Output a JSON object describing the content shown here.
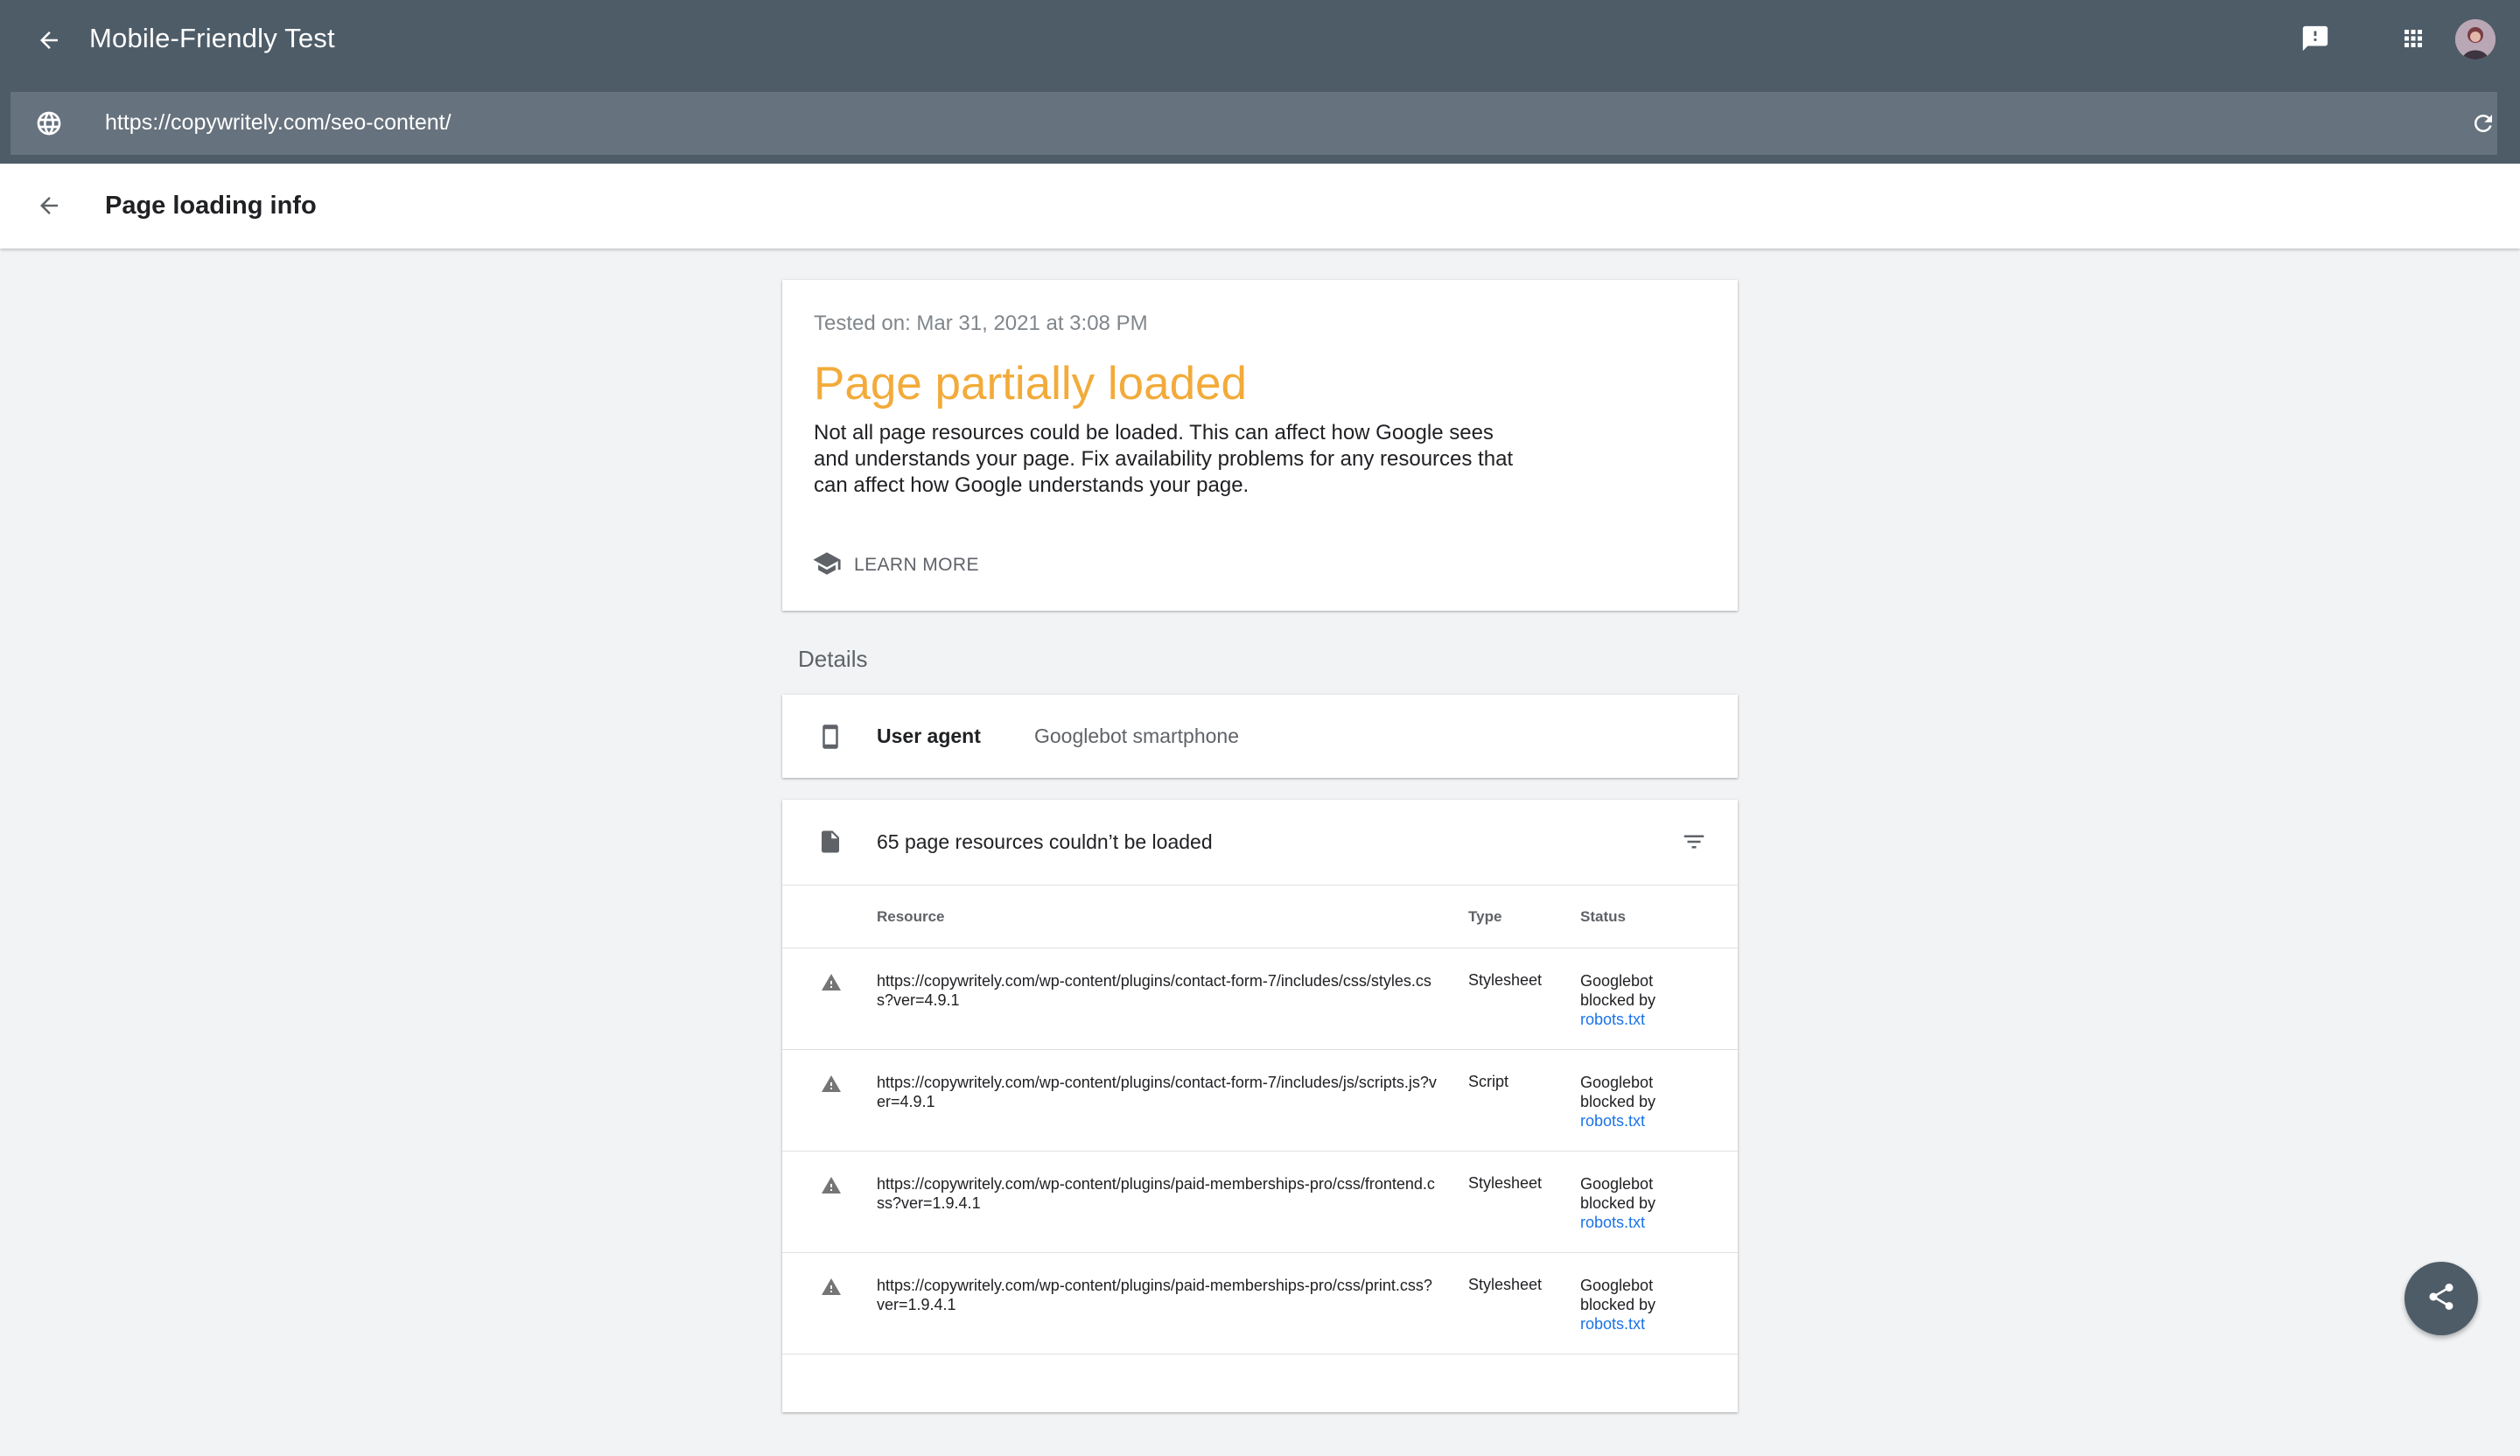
{
  "appbar": {
    "title": "Mobile-Friendly Test",
    "url": "https://copywritely.com/seo-content/",
    "icons": [
      "back-arrow-icon",
      "feedback-icon",
      "apps-grid-icon",
      "globe-icon",
      "reload-icon"
    ]
  },
  "subheader": {
    "title": "Page loading info"
  },
  "summary": {
    "tested_on": "Tested on: Mar 31, 2021 at 3:08 PM",
    "verdict": "Page partially loaded",
    "verdict_color": "#f2ab3a",
    "description": "Not all page resources could be loaded. This can affect how Google sees and understands your page. Fix availability problems for any resources that can affect how Google understands your page.",
    "learn_more": "LEARN MORE"
  },
  "details": {
    "label": "Details",
    "user_agent_label": "User agent",
    "user_agent_value": "Googlebot smartphone"
  },
  "resources": {
    "count_text": "65 page resources couldn’t be loaded",
    "headers": {
      "resource": "Resource",
      "type": "Type",
      "status": "Status"
    },
    "rows": [
      {
        "resource": "https://copywritely.com/wp-content/plugins/contact-form-7/includes/css/styles.css?ver=4.9.1",
        "type": "Stylesheet",
        "status": "Googlebot blocked by",
        "link": "robots.txt"
      },
      {
        "resource": "https://copywritely.com/wp-content/plugins/contact-form-7/includes/js/scripts.js?ver=4.9.1",
        "type": "Script",
        "status": "Googlebot blocked by",
        "link": "robots.txt"
      },
      {
        "resource": "https://copywritely.com/wp-content/plugins/paid-memberships-pro/css/frontend.css?ver=1.9.4.1",
        "type": "Stylesheet",
        "status": "Googlebot blocked by",
        "link": "robots.txt"
      },
      {
        "resource": "https://copywritely.com/wp-content/plugins/paid-memberships-pro/css/print.css?ver=1.9.4.1",
        "type": "Stylesheet",
        "status": "Googlebot blocked by",
        "link": "robots.txt"
      }
    ]
  },
  "colors": {
    "appbar": "#4e5c68",
    "urlbar": "#66727d",
    "link": "#1a73e8",
    "background": "#f1f3f4"
  }
}
